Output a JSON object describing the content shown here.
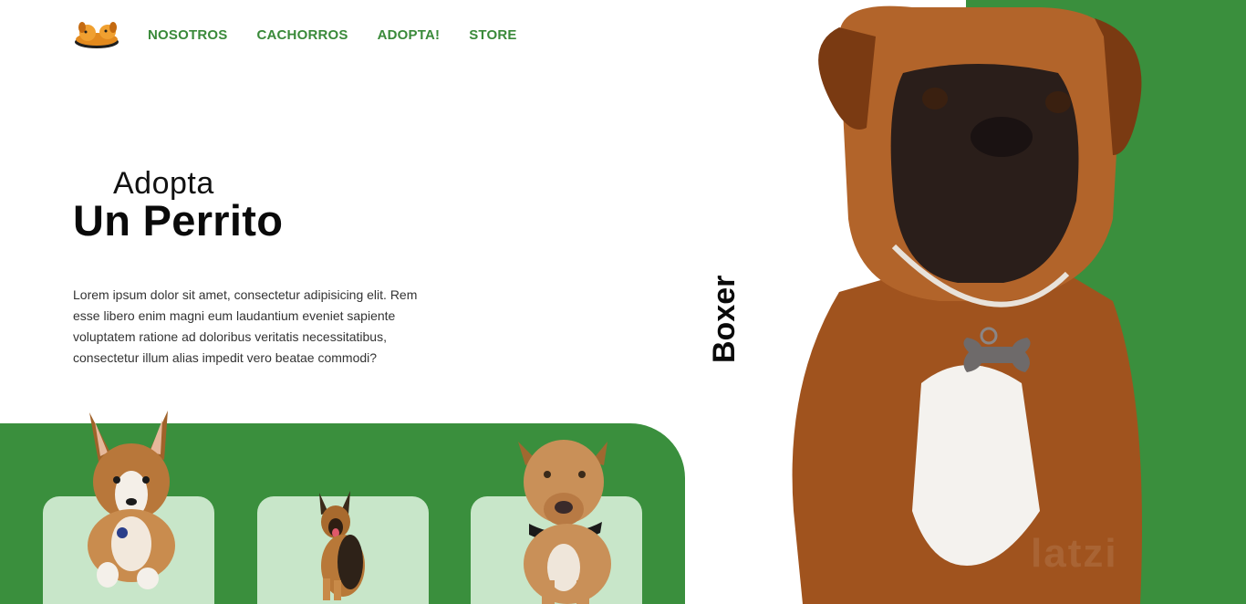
{
  "nav": {
    "items": [
      "NOSOTROS",
      "CACHORROS",
      "ADOPTA!",
      "STORE"
    ]
  },
  "hero": {
    "subtitle": "Adopta",
    "title": "Un Perrito",
    "description": "Lorem ipsum dolor sit amet, consectetur adipisicing elit. Rem esse libero enim magni eum laudantium eveniet sapiente voluptatem ratione ad doloribus veritatis necessitatibus, consectetur illum alias impedit vero beatae commodi?"
  },
  "featured": {
    "breed": "Boxer"
  },
  "watermark": "latzi",
  "colors": {
    "brand_green": "#3a8f3d",
    "nav_green": "#3a8a3a",
    "card_green": "#c8e6c9"
  }
}
